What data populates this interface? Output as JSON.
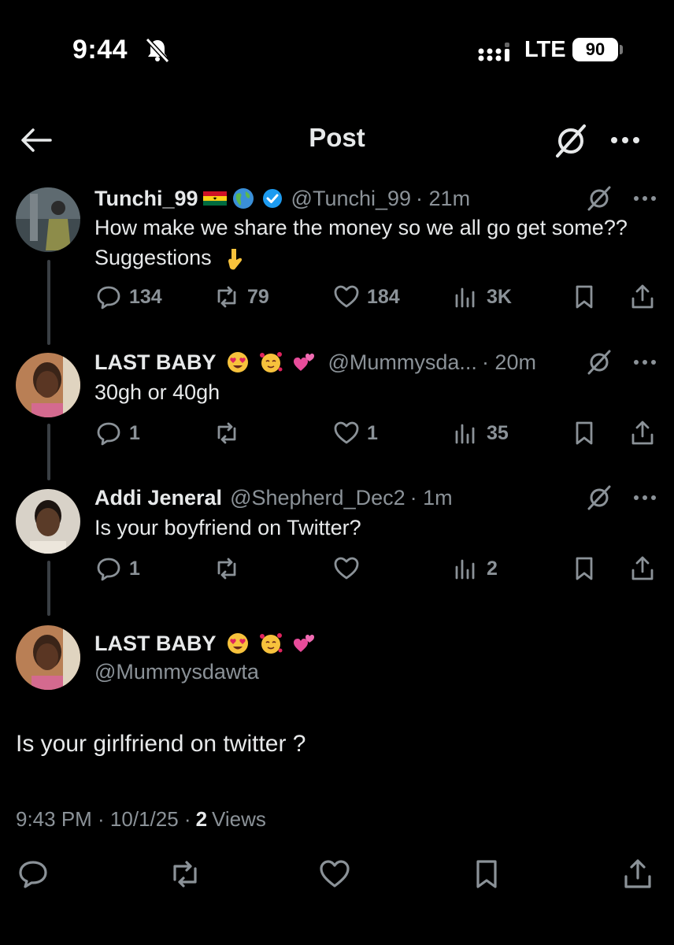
{
  "status_bar": {
    "time": "9:44",
    "network": "LTE",
    "battery": "90"
  },
  "header": {
    "title": "Post"
  },
  "replies": [
    {
      "name": "Tunchi_99",
      "handle": "@Tunchi_99",
      "time": "· 21m",
      "text": "How make we share the money so we all go get some?? Suggestions",
      "replies": "134",
      "reposts": "79",
      "likes": "184",
      "views": "3K"
    },
    {
      "name": "LAST BABY",
      "handle": "@Mummysda...",
      "time": "· 20m",
      "text": "30gh or 40gh",
      "replies": "1",
      "reposts": "",
      "likes": "1",
      "views": "35"
    },
    {
      "name": "Addi Jeneral",
      "handle": "@Shepherd_Dec2",
      "time": "· 1m",
      "text": "Is your boyfriend on Twitter?",
      "replies": "1",
      "reposts": "",
      "likes": "",
      "views": "2"
    }
  ],
  "main_post": {
    "name": "LAST BABY",
    "handle": "@Mummysdawta",
    "text": "Is your girlfriend on twitter ?",
    "timestamp": "9:43 PM · 10/1/25 ·",
    "views_count": "2",
    "views_label": "Views"
  },
  "colors": {
    "background": "#000000",
    "text": "#e7e9ea",
    "secondary": "#8b9298",
    "verified": "#1d9bf0",
    "thread_line": "#3a3f44"
  }
}
